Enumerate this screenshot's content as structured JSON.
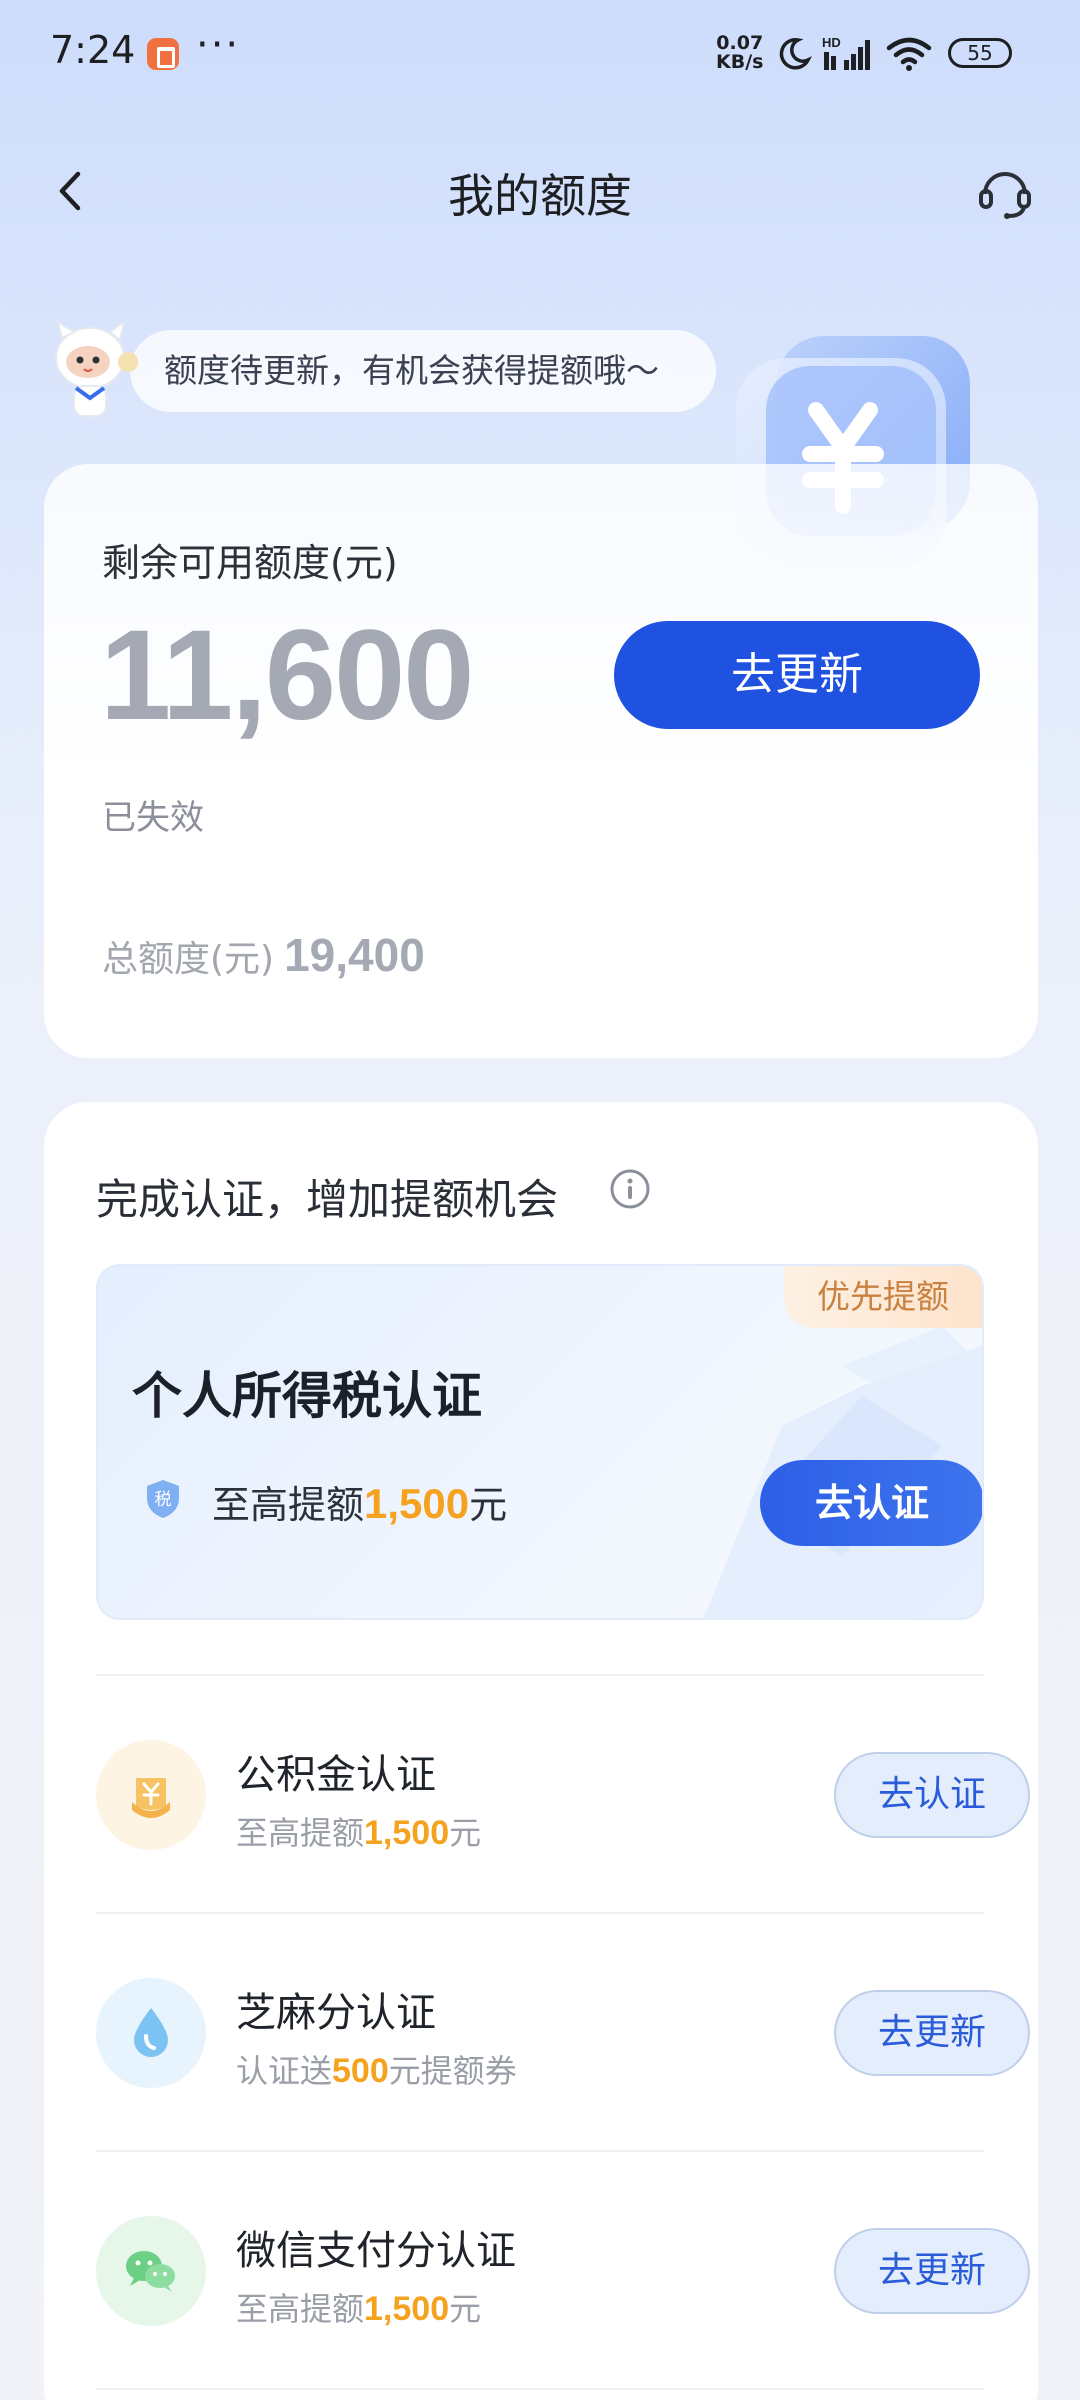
{
  "status_bar": {
    "time": "7:24",
    "dots": "···",
    "net_speed_value": "0.07",
    "net_speed_unit": "KB/s",
    "signal_label": "HD",
    "battery": "55"
  },
  "header": {
    "title": "我的额度"
  },
  "tip": {
    "text": "额度待更新，有机会获得提额哦～"
  },
  "quota": {
    "label": "剩余可用额度(元)",
    "value": "11,600",
    "update_button": "去更新",
    "status": "已失效",
    "total_label": "总额度(元)",
    "total_value": "19,400"
  },
  "certification": {
    "title": "完成认证，增加提额机会",
    "featured": {
      "badge": "优先提额",
      "name": "个人所得税认证",
      "shield_label": "税",
      "desc_prefix": "至高提额",
      "desc_amount": "1,500",
      "desc_suffix": "元",
      "button": "去认证"
    },
    "items": [
      {
        "name": "公积金认证",
        "desc_prefix": "至高提额",
        "desc_amount": "1,500",
        "desc_suffix": "元",
        "button": "去认证",
        "icon": "housing-fund-icon"
      },
      {
        "name": "芝麻分认证",
        "desc_prefix": "认证送",
        "desc_amount": "500",
        "desc_suffix": "元提额券",
        "button": "去更新",
        "icon": "sesame-drop-icon"
      },
      {
        "name": "微信支付分认证",
        "desc_prefix": "至高提额",
        "desc_amount": "1,500",
        "desc_suffix": "元",
        "button": "去更新",
        "icon": "wechat-icon"
      }
    ]
  },
  "colors": {
    "primary": "#2052e2",
    "highlight": "#f5a21f",
    "badge_text": "#c9823f"
  }
}
